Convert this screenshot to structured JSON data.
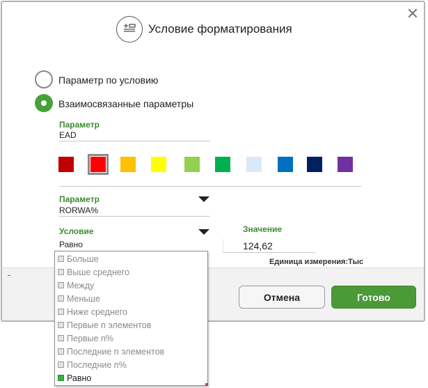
{
  "dialog": {
    "title": "Условие форматирования",
    "close_icon": "close-icon",
    "title_icon": "format-condition-icon"
  },
  "radios": [
    {
      "label": "Параметр по условию",
      "selected": false
    },
    {
      "label": "Взаимосвязанные параметры",
      "selected": true
    }
  ],
  "param1": {
    "label": "Параметр",
    "value": "EAD"
  },
  "swatches": [
    {
      "color": "#c00000",
      "selected": false
    },
    {
      "color": "#ff0000",
      "selected": true
    },
    {
      "color": "#ffc000",
      "selected": false
    },
    {
      "color": "#ffff00",
      "selected": false
    },
    {
      "color": "#92d050",
      "selected": false
    },
    {
      "color": "#00b050",
      "selected": false
    },
    {
      "color": "#dae9f8",
      "selected": false
    },
    {
      "color": "#0070c0",
      "selected": false
    },
    {
      "color": "#002060",
      "selected": false
    },
    {
      "color": "#7030a0",
      "selected": false
    }
  ],
  "param2": {
    "label": "Параметр",
    "value": "RORWA%"
  },
  "condition": {
    "label": "Условие",
    "value": "Равно"
  },
  "value_field": {
    "label": "Значение",
    "value": "124,62"
  },
  "unit_text": "Единица измерения:Тыс",
  "buttons": {
    "cancel": "Отмена",
    "ok": "Готово"
  },
  "condition_options": [
    "Больше",
    "Выше среднего",
    "Между",
    "Меньше",
    "Ниже среднего",
    "Первые n элементов",
    "Первые n%",
    "Последние n элементов",
    "Последние n%",
    "Равно"
  ],
  "selected_option": "Равно"
}
